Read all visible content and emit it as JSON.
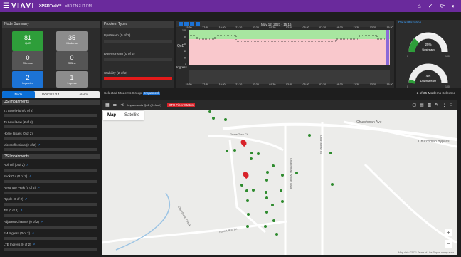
{
  "header": {
    "menu": "☰",
    "logo": "VIAVI",
    "product": "XPERTrak™",
    "cmts": "cBR FN-3-IT-RM"
  },
  "node_summary": {
    "title": "Node Summary",
    "tiles": [
      {
        "value": "81",
        "label": "QoE"
      },
      {
        "value": "35",
        "label": "Modems"
      },
      {
        "value": "0",
        "label": "Chronic"
      },
      {
        "value": "0",
        "label": "Offline"
      },
      {
        "value": "2",
        "label": "Impacted"
      },
      {
        "value": "1",
        "label": "Ingress"
      }
    ]
  },
  "problem_types": {
    "title": "Problem Types",
    "items": [
      {
        "label": "Upstream (0 of 2)"
      },
      {
        "label": "Downstream (0 of 2)"
      },
      {
        "label": "Stability (2 of 2)"
      }
    ]
  },
  "chart": {
    "date": "May 12, 2021 - 15:16",
    "qoe_label": "QoE",
    "ingress_label": "Ingress",
    "times": [
      "15:30",
      "17:30",
      "19:30",
      "21:30",
      "23:30",
      "01:30",
      "03:30",
      "05:30",
      "07:30",
      "09:30",
      "11:30",
      "13:30",
      "15:30"
    ],
    "qoe_ticks": [
      "100",
      "80",
      "60",
      "40",
      "20",
      "0"
    ]
  },
  "utilization": {
    "title": "Data Utilization",
    "gauges": [
      {
        "title": "Maximum",
        "value": "25%",
        "label": "Upstream",
        "min": "0",
        "max": "100",
        "fill": 0.25
      },
      {
        "title": "",
        "value": "4%",
        "label": "Downstream",
        "min": "0",
        "max": "100",
        "fill": 0.04
      }
    ]
  },
  "tabs": [
    "Node",
    "DOCSIS 3.1",
    "Alarm"
  ],
  "us_title": "US Impairments",
  "us": [
    {
      "label": "Tx Level High (0 of 2)",
      "bad": false
    },
    {
      "label": "Tx Level Low (2 of 2)",
      "bad": true
    },
    {
      "label": "Home Issues (0 of 2)",
      "bad": false
    },
    {
      "label": "Microreflections (2 of 2)",
      "bad": true,
      "link": "↗"
    }
  ],
  "ds_title": "DS Impairments",
  "ds": [
    {
      "label": "Roll Off (0 of 2)",
      "link": "↗"
    },
    {
      "label": "Suck Out (0 of 2)",
      "link": "↗"
    },
    {
      "label": "Resonate Peak (0 of 2)",
      "link": "↗"
    },
    {
      "label": "Ripple (0 of 2)",
      "link": "↗"
    },
    {
      "label": "Tilt (0 of 2)",
      "link": "↗"
    },
    {
      "label": "Adjacent Channel (0 of 2)",
      "link": "↗"
    },
    {
      "label": "FM Ingress (0 of 2)",
      "link": "↗"
    },
    {
      "label": "LTE Ingress (0 of 2)",
      "link": "↗"
    }
  ],
  "map": {
    "group_label": "Selected Modems Group",
    "group_value": "Impacted",
    "selected": "2 of 35 Modems Selected",
    "impairments": "Impairments",
    "qoe": "QoE (Default)",
    "otu": "OTU Fiber Status",
    "tab_map": "Map",
    "tab_sat": "Satellite",
    "roads": [
      "Churchman Ave",
      "Churchman Bypass",
      "Grove Tree Ct",
      "Grove Tree Ln",
      "Churchman Woods Blvd",
      "Forest Run Ln",
      "Forest Run Ct",
      "Churchman Creek",
      "Churchman Rd",
      "Glenn Rd"
    ],
    "footer": "Map data ©2021   Terms of Use   Report a map error",
    "plus": "+",
    "minus": "−"
  }
}
